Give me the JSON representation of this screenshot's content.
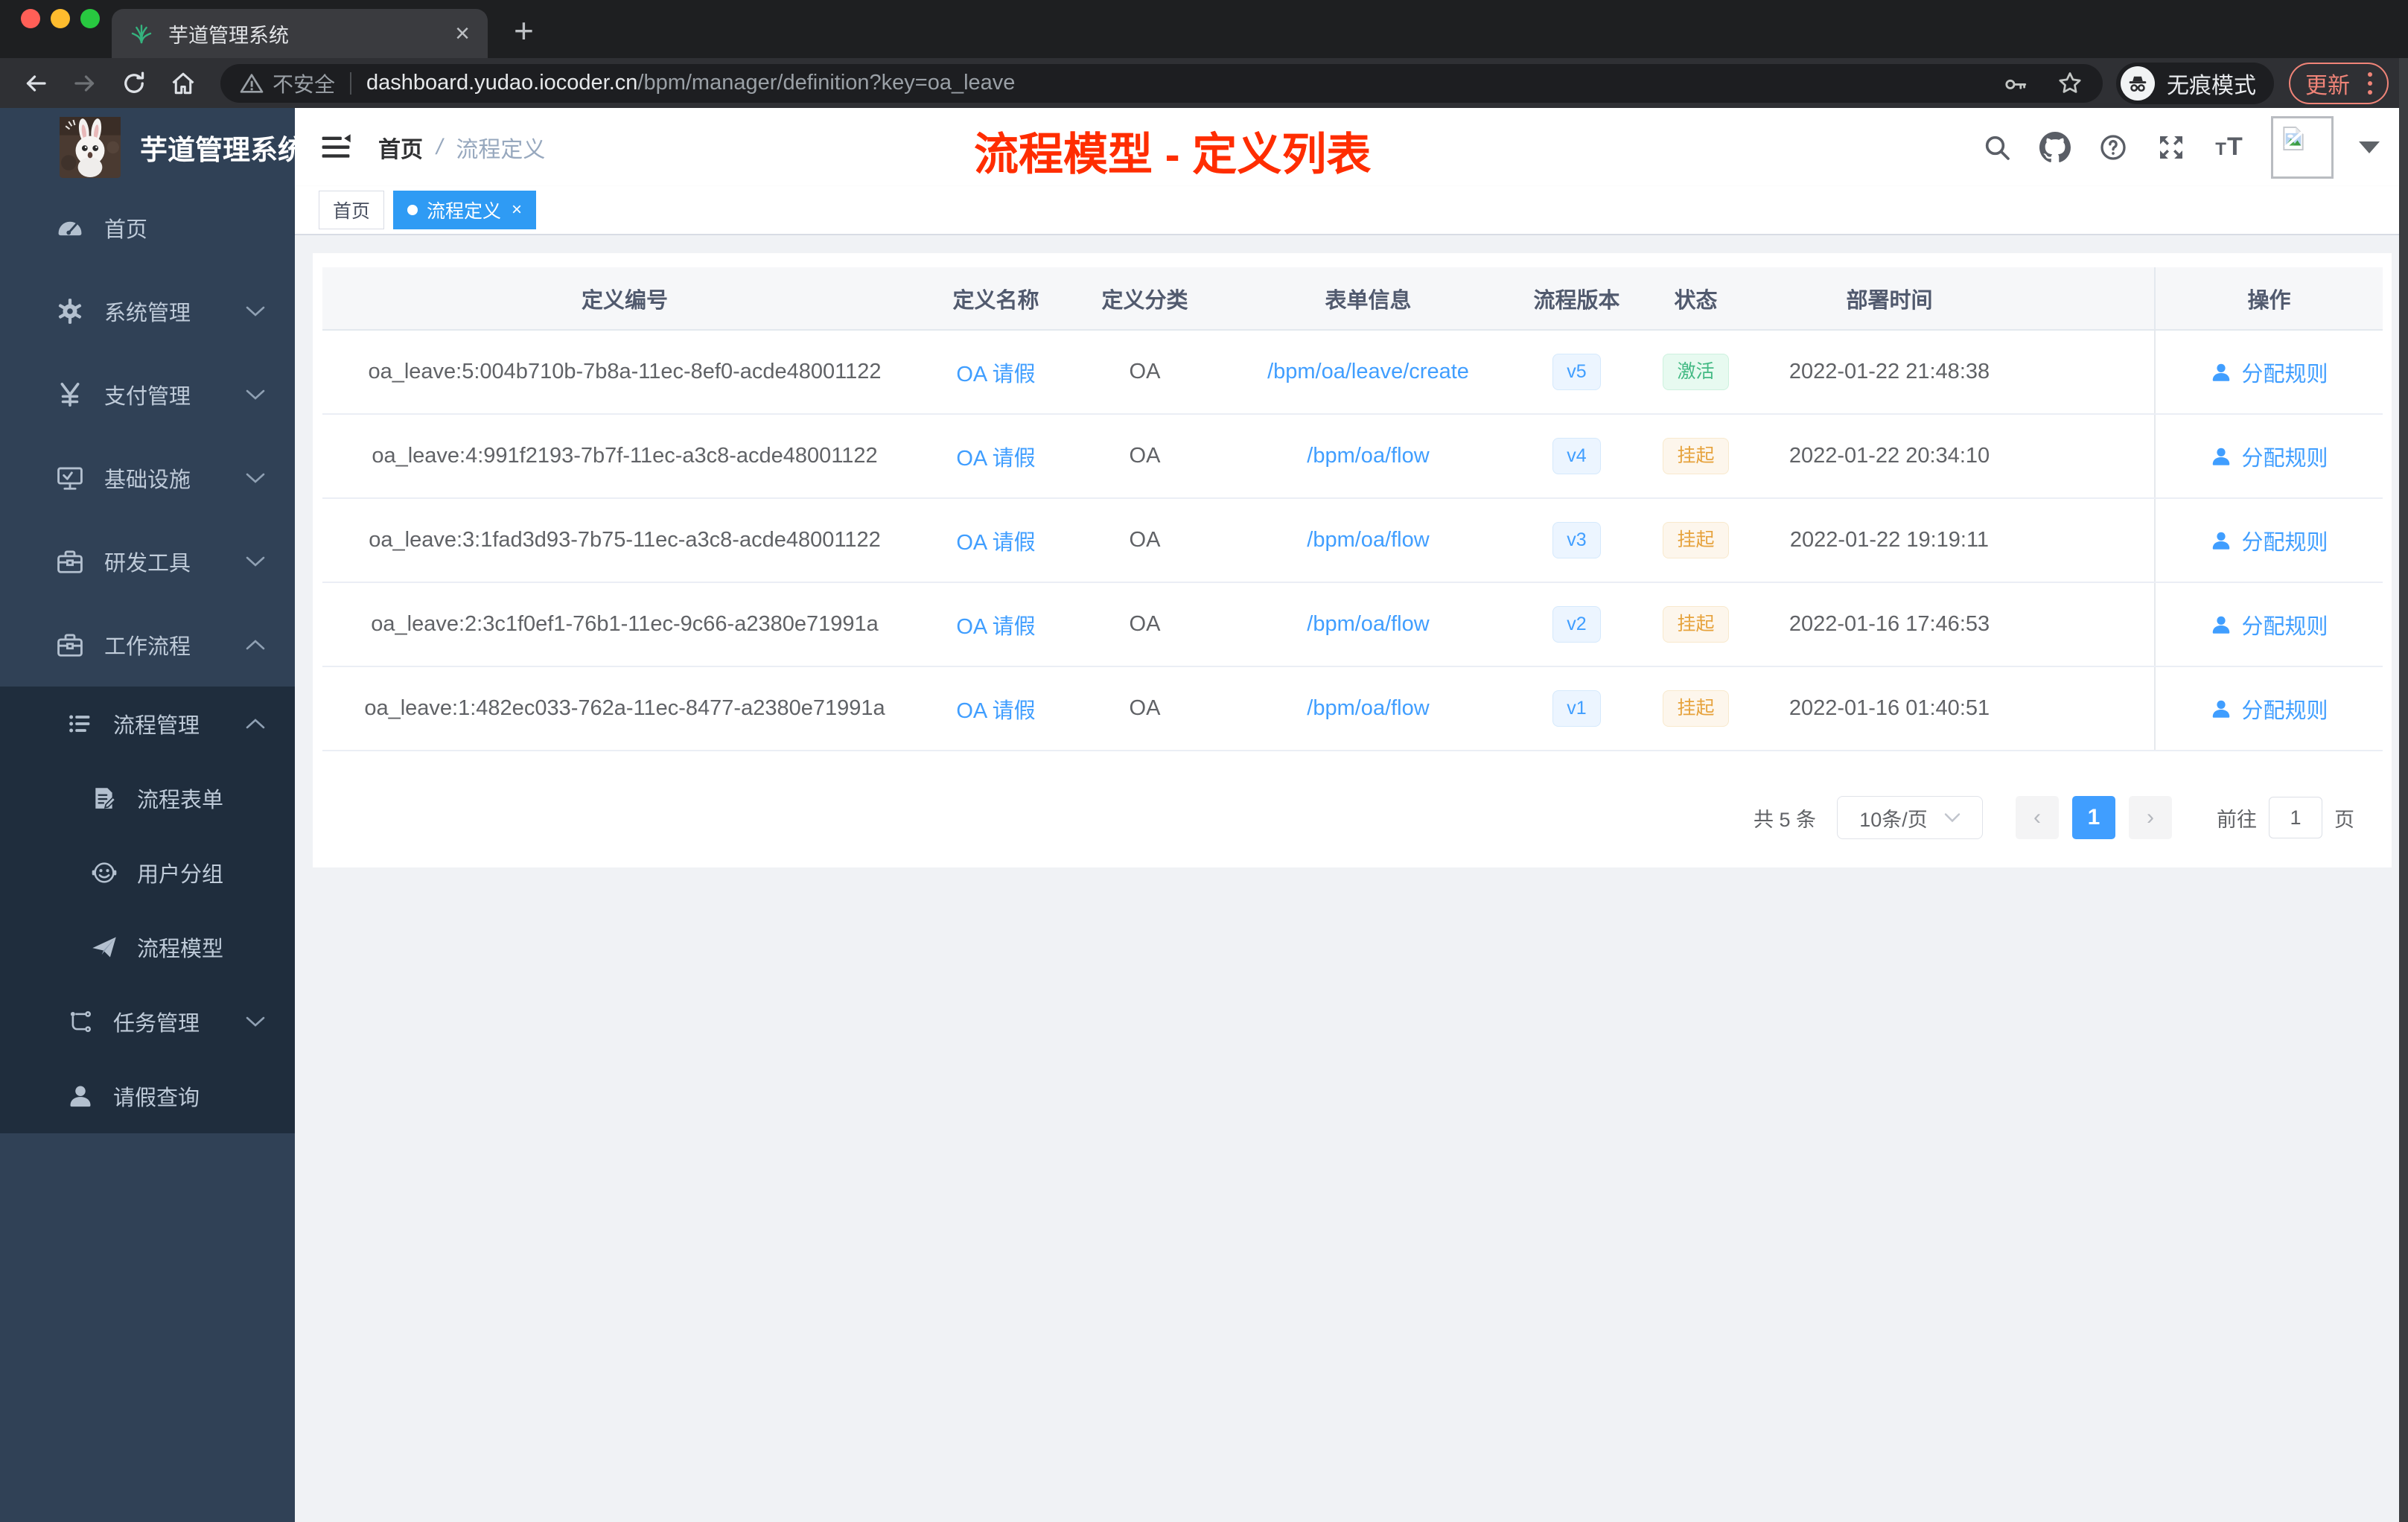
{
  "browser": {
    "tab": {
      "title": "芋道管理系统",
      "close": "×",
      "new_tab": "+"
    },
    "address": {
      "security": "不安全",
      "host": "dashboard.yudao.iocoder.cn",
      "path": "/bpm/manager/definition?key=oa_leave"
    },
    "incognito_label": "无痕模式",
    "update_button": "更新"
  },
  "sidebar": {
    "logo_title": "芋道管理系统",
    "items": [
      {
        "label": "首页"
      },
      {
        "label": "系统管理"
      },
      {
        "label": "支付管理"
      },
      {
        "label": "基础设施"
      },
      {
        "label": "研发工具"
      },
      {
        "label": "工作流程"
      }
    ],
    "workflow_submenu": [
      {
        "label": "流程管理"
      },
      {
        "label": "流程表单"
      },
      {
        "label": "用户分组"
      },
      {
        "label": "流程模型"
      },
      {
        "label": "任务管理"
      },
      {
        "label": "请假查询"
      }
    ]
  },
  "header": {
    "breadcrumb": {
      "home": "首页",
      "separator": "/",
      "current": "流程定义"
    },
    "annotation_title": "流程模型 - 定义列表"
  },
  "tags": [
    {
      "label": "首页"
    },
    {
      "label": "流程定义",
      "close": "×"
    }
  ],
  "table": {
    "columns": [
      "定义编号",
      "定义名称",
      "定义分类",
      "表单信息",
      "流程版本",
      "状态",
      "部署时间",
      "操作"
    ],
    "rows": [
      {
        "id": "oa_leave:5:004b710b-7b8a-11ec-8ef0-acde48001122",
        "name": "OA 请假",
        "category": "OA",
        "form": "/bpm/oa/leave/create",
        "version": "v5",
        "status": "激活",
        "status_type": "success",
        "deployed_at": "2022-01-22 21:48:38",
        "action": "分配规则"
      },
      {
        "id": "oa_leave:4:991f2193-7b7f-11ec-a3c8-acde48001122",
        "name": "OA 请假",
        "category": "OA",
        "form": "/bpm/oa/flow",
        "version": "v4",
        "status": "挂起",
        "status_type": "warning",
        "deployed_at": "2022-01-22 20:34:10",
        "action": "分配规则"
      },
      {
        "id": "oa_leave:3:1fad3d93-7b75-11ec-a3c8-acde48001122",
        "name": "OA 请假",
        "category": "OA",
        "form": "/bpm/oa/flow",
        "version": "v3",
        "status": "挂起",
        "status_type": "warning",
        "deployed_at": "2022-01-22 19:19:11",
        "action": "分配规则"
      },
      {
        "id": "oa_leave:2:3c1f0ef1-76b1-11ec-9c66-a2380e71991a",
        "name": "OA 请假",
        "category": "OA",
        "form": "/bpm/oa/flow",
        "version": "v2",
        "status": "挂起",
        "status_type": "warning",
        "deployed_at": "2022-01-16 17:46:53",
        "action": "分配规则"
      },
      {
        "id": "oa_leave:1:482ec033-762a-11ec-8477-a2380e71991a",
        "name": "OA 请假",
        "category": "OA",
        "form": "/bpm/oa/flow",
        "version": "v1",
        "status": "挂起",
        "status_type": "warning",
        "deployed_at": "2022-01-16 01:40:51",
        "action": "分配规则"
      }
    ]
  },
  "pagination": {
    "total": "共 5 条",
    "page_size": "10条/页",
    "prev": "‹",
    "current_page": "1",
    "next": "›",
    "goto_label": "前往",
    "goto_value": "1",
    "goto_unit": "页"
  },
  "colors": {
    "accent": "#409eff",
    "tag_active": "#2f9bf4",
    "success": "#42b983",
    "warning": "#e6a23c",
    "annotation_red": "#ff2d00",
    "sidebar_bg": "#304156",
    "submenu_bg": "#1f2d3d",
    "chrome_update_red": "#f08478"
  }
}
